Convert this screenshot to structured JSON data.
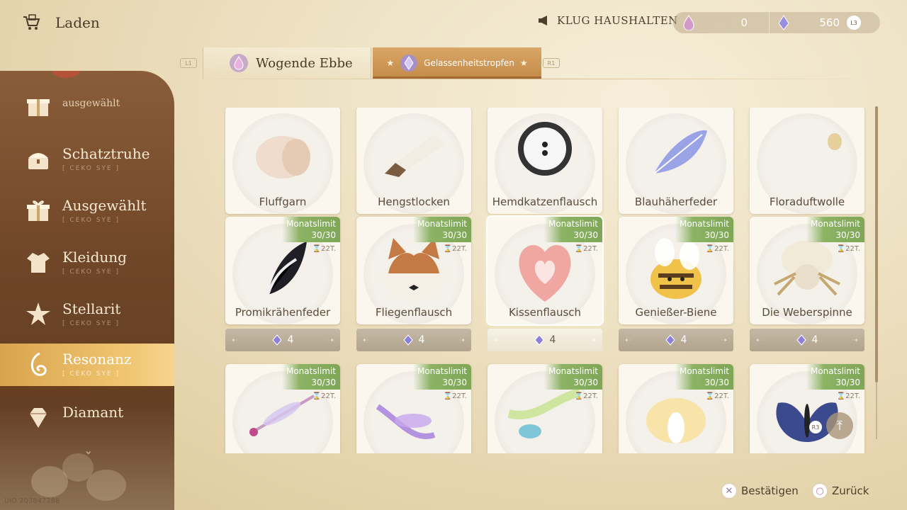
{
  "header": {
    "title": "Laden"
  },
  "budget": {
    "label": "KLUG HAUSHALTEN"
  },
  "currency": {
    "first_value": "0",
    "second_value": "560",
    "hint": "L3"
  },
  "tabs": {
    "left_hint": "L1",
    "right_hint": "R1",
    "items": [
      {
        "label": "Wogende Ebbe"
      },
      {
        "label": "Gelassenheitstropfen",
        "active": true
      }
    ]
  },
  "sidebar": {
    "items": [
      {
        "label": "ausgewählt",
        "sub": ""
      },
      {
        "label": "Schatztruhe",
        "sub": "[ CEKO SYE ]"
      },
      {
        "label": "Ausgewählt",
        "sub": "[ CEKO SYE ]"
      },
      {
        "label": "Kleidung",
        "sub": "[ CEKO SYE ]"
      },
      {
        "label": "Stellarit",
        "sub": "[ CEKO SYE ]"
      },
      {
        "label": "Resonanz",
        "sub": "[ CEKO SYE ]",
        "active": true
      },
      {
        "label": "Diamant",
        "sub": ""
      }
    ]
  },
  "uid": "UID 203847288",
  "items": [
    {
      "name": "Fluffgarn",
      "price": "4"
    },
    {
      "name": "Hengstlocken",
      "price": "4"
    },
    {
      "name": "Hemdkatzenflausch",
      "price": "4"
    },
    {
      "name": "Blauhäherfeder",
      "price": "4"
    },
    {
      "name": "Floraduftwolle",
      "price": "4"
    },
    {
      "name": "Promikrähenfeder",
      "price": "4",
      "limit_label": "Monatslimit",
      "limit": "30/30",
      "timer": "22T."
    },
    {
      "name": "Fliegenflausch",
      "price": "4",
      "limit_label": "Monatslimit",
      "limit": "30/30",
      "timer": "22T."
    },
    {
      "name": "Kissenflausch",
      "price": "4",
      "limit_label": "Monatslimit",
      "limit": "30/30",
      "timer": "22T.",
      "selected": true
    },
    {
      "name": "Genießer-Biene",
      "price": "4",
      "limit_label": "Monatslimit",
      "limit": "30/30",
      "timer": "22T."
    },
    {
      "name": "Die Weberspinne",
      "price": "4",
      "limit_label": "Monatslimit",
      "limit": "30/30",
      "timer": "22T."
    },
    {
      "name": "",
      "price": "",
      "limit_label": "Monatslimit",
      "limit": "30/30",
      "timer": "22T."
    },
    {
      "name": "",
      "price": "",
      "limit_label": "Monatslimit",
      "limit": "30/30",
      "timer": "22T."
    },
    {
      "name": "",
      "price": "",
      "limit_label": "Monatslimit",
      "limit": "30/30",
      "timer": "22T."
    },
    {
      "name": "",
      "price": "",
      "limit_label": "Monatslimit",
      "limit": "30/30",
      "timer": "22T."
    },
    {
      "name": "",
      "price": "",
      "limit_label": "Monatslimit",
      "limit": "30/30",
      "timer": "22T."
    }
  ],
  "scroll": {
    "hint": "R3"
  },
  "footer": {
    "confirm": "Bestätigen",
    "back": "Zurück"
  },
  "colors": {
    "accent": "#d9a44e",
    "limit_badge": "#8cb364",
    "sidebar": "#6e4527"
  }
}
